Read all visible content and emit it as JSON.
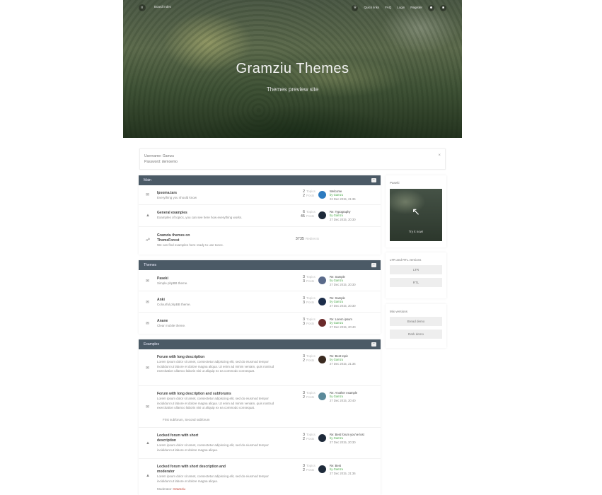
{
  "topbar": {
    "menu_icon": "≡",
    "board_index": "Board index",
    "links": [
      "Quick links",
      "FAQ",
      "Login",
      "Register"
    ]
  },
  "hero": {
    "title": "Gramziu Themes",
    "subtitle": "Themes preview site"
  },
  "notice": {
    "line1": "Username: Gamzu",
    "line2": "Password: demoemo",
    "close": "×"
  },
  "sections": {
    "main": {
      "title": "Main",
      "forums": [
        {
          "title": "Ipsoma.tars",
          "desc": "Everything you should know",
          "topics": "2",
          "posts": "2",
          "topics_label": "Topics",
          "posts_label": "Posts",
          "last_title": "Welcome",
          "last_by": "by Gamzu",
          "last_date": "22 Dec 2015, 21:36"
        },
        {
          "title": "General examples",
          "desc": "Examples of topics, you can see here how everything works.",
          "topics": "6",
          "posts": "45",
          "topics_label": "Topics",
          "posts_label": "Posts",
          "last_title": "Re: Typography",
          "last_by": "by Gamzu",
          "last_date": "27 Dec 2015, 20:30"
        },
        {
          "title": "Gramziu themes on",
          "title2": "ThemeForest",
          "desc": "We can find examples here ready to use tonce.",
          "redirects": "3735",
          "redirects_label": "Redirects"
        }
      ]
    },
    "themes": {
      "title": "Themes",
      "forums": [
        {
          "title": "Paseki",
          "desc": "Simple phpBB theme.",
          "topics": "3",
          "posts": "3",
          "topics_label": "Topics",
          "posts_label": "Posts",
          "last_title": "Re: Sample",
          "last_by": "by Gamzu",
          "last_date": "27 Dec 2015, 20:30"
        },
        {
          "title": "Anki",
          "desc": "Colourful phpBB theme.",
          "topics": "3",
          "posts": "3",
          "topics_label": "Topics",
          "posts_label": "Posts",
          "last_title": "Re: Sample",
          "last_by": "by Gamzu",
          "last_date": "27 Dec 2015, 20:30"
        },
        {
          "title": "Anane",
          "desc": "Clear mobile theme.",
          "topics": "3",
          "posts": "3",
          "topics_label": "Topics",
          "posts_label": "Posts",
          "last_title": "Re: Lorem ipsum",
          "last_by": "by Gamzu",
          "last_date": "27 Dec 2015, 20:40"
        }
      ]
    },
    "examples": {
      "title": "Examples",
      "forums": [
        {
          "title": "Forum with long description",
          "desc": "Lorem ipsum dolor sit amet, consectetur adipiscing elit, sed do eiusmod tempor incididunt ut labore et dolore magna aliqua. Ut enim ad minim veniam, quis nostrud exercitation ullamco laboris nisi ut aliquip ex ea commodo consequat.",
          "topics": "3",
          "posts": "2",
          "topics_label": "Topics",
          "posts_label": "Posts",
          "last_title": "Re: Best topic",
          "last_by": "by Gamzu",
          "last_date": "27 Dec 2015, 21:36"
        },
        {
          "title": "Forum with long description and subforums",
          "desc": "Lorem ipsum dolor sit amet, consectetur adipiscing elit, sed do eiusmod tempor incididunt ut labore et dolore magna aliqua. Ut enim ad minim veniam, quis nostrud exercitation ullamco laboris nisi ut aliquip ex ea commodo consequat.",
          "subforums": "First subforum,  Second subforum",
          "topics": "3",
          "posts": "2",
          "topics_label": "Topics",
          "posts_label": "Posts",
          "last_title": "Re: Another example",
          "last_by": "by Gamzu",
          "last_date": "27 Dec 2015, 20:40"
        },
        {
          "title": "Locked forum with short",
          "title2": "description",
          "desc": "Lorem ipsum dolor sit amet, consectetur adipiscing elit, sed do eiusmod tempor incididunt ut labore et dolore magna aliqua.",
          "topics": "3",
          "posts": "2",
          "topics_label": "Topics",
          "posts_label": "Posts",
          "last_title": "Re: Best forum you've lost",
          "last_by": "by Gamzu",
          "last_date": "27 Dec 2015, 20:30"
        },
        {
          "title": "Locked forum with short description and",
          "title2": "moderator",
          "desc": "Lorem ipsum dolor sit amet, consectetur adipiscing elit, sed do eiusmod tempor incididunt ut labore et dolore magna aliqua.",
          "moderator_label": "Moderator:",
          "moderator": "Gramziu",
          "topics": "3",
          "posts": "2",
          "topics_label": "Topics",
          "posts_label": "Posts",
          "last_title": "Re: Best",
          "last_by": "by Gamzu",
          "last_date": "27 Dec 2015, 21:36"
        }
      ]
    }
  },
  "sidebar": {
    "panels": {
      "poster_title": "Paseki",
      "poster_caption": "Try it now!",
      "ltr_title": "LTR and RTL versions",
      "ltr_buttons": [
        "LTR",
        "RTL"
      ],
      "mix_title": "Mix versions",
      "mix_buttons": [
        "Bread demo",
        "Dark demo"
      ]
    }
  },
  "colors": {
    "section_header": "#4b5a66",
    "moderator_link": "#c0392b",
    "author_link": "#4aa84a"
  }
}
